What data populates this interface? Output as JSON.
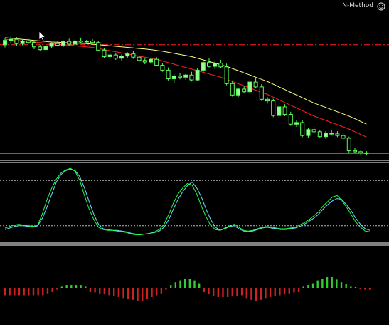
{
  "indicator_label": "N-Method",
  "smiley_icon": "smiley-icon",
  "colors": {
    "background": "#000000",
    "bull_candle": "#9aff9a",
    "bear_candle": "#000000",
    "wick": "#5cff5c",
    "ma_red": "#ff2020",
    "ma_yellow": "#ffff80",
    "dash_red": "#ff2020",
    "price_line": "#8fa0c8",
    "stoch_main": "#66e0ff",
    "stoch_signal": "#22ff44",
    "hist_pos": "#33cc33",
    "hist_neg": "#cc2222",
    "separator": "#ffffff"
  },
  "chart_data": [
    {
      "type": "candlestick",
      "panel": "price",
      "ohlc": [
        [
          100,
          101.2,
          99.5,
          100.8
        ],
        [
          100.8,
          101.5,
          100.2,
          101.0
        ],
        [
          101.0,
          101.4,
          99.8,
          100.2
        ],
        [
          100.2,
          101.0,
          99.9,
          100.7
        ],
        [
          100.7,
          101.1,
          100.1,
          100.4
        ],
        [
          100.4,
          100.8,
          99.2,
          99.6
        ],
        [
          99.6,
          100.0,
          98.9,
          99.1
        ],
        [
          99.1,
          99.9,
          98.8,
          99.7
        ],
        [
          99.7,
          100.4,
          99.3,
          100.2
        ],
        [
          100.2,
          100.6,
          99.7,
          99.9
        ],
        [
          99.9,
          100.8,
          99.6,
          100.6
        ],
        [
          100.6,
          101.1,
          99.9,
          100.1
        ],
        [
          100.1,
          100.9,
          99.8,
          100.7
        ],
        [
          100.7,
          101.3,
          100.2,
          100.5
        ],
        [
          100.5,
          100.9,
          100.1,
          100.7
        ],
        [
          100.7,
          101.0,
          100.2,
          100.4
        ],
        [
          100.4,
          100.7,
          98.8,
          99.0
        ],
        [
          99.0,
          99.4,
          97.5,
          97.8
        ],
        [
          97.8,
          98.4,
          97.3,
          98.1
        ],
        [
          98.1,
          98.5,
          97.2,
          97.5
        ],
        [
          97.5,
          98.2,
          97.1,
          97.9
        ],
        [
          97.9,
          98.6,
          97.6,
          98.3
        ],
        [
          98.3,
          98.8,
          97.4,
          97.7
        ],
        [
          97.7,
          98.0,
          96.8,
          97.1
        ],
        [
          97.1,
          97.6,
          96.4,
          96.8
        ],
        [
          96.8,
          97.5,
          96.5,
          97.3
        ],
        [
          97.3,
          97.7,
          96.0,
          96.2
        ],
        [
          96.2,
          96.6,
          95.0,
          95.3
        ],
        [
          95.3,
          95.8,
          93.4,
          93.7
        ],
        [
          93.7,
          94.5,
          93.0,
          94.2
        ],
        [
          94.2,
          94.8,
          93.6,
          94.0
        ],
        [
          94.0,
          94.6,
          93.5,
          94.4
        ],
        [
          94.4,
          95.0,
          93.2,
          93.5
        ],
        [
          93.5,
          95.6,
          93.3,
          95.3
        ],
        [
          95.3,
          97.0,
          94.9,
          96.7
        ],
        [
          96.7,
          97.5,
          95.8,
          96.0
        ],
        [
          96.0,
          96.9,
          95.5,
          96.6
        ],
        [
          96.6,
          97.2,
          95.7,
          95.9
        ],
        [
          95.9,
          96.5,
          92.5,
          92.8
        ],
        [
          92.8,
          93.4,
          90.4,
          90.7
        ],
        [
          90.7,
          92.0,
          90.3,
          91.8
        ],
        [
          91.8,
          92.4,
          91.0,
          91.3
        ],
        [
          91.3,
          93.4,
          91.0,
          93.1
        ],
        [
          93.1,
          93.8,
          91.9,
          92.2
        ],
        [
          92.2,
          92.7,
          89.6,
          89.9
        ],
        [
          89.9,
          90.3,
          89.1,
          89.6
        ],
        [
          89.6,
          90.0,
          86.6,
          86.9
        ],
        [
          86.9,
          88.8,
          86.5,
          88.5
        ],
        [
          88.5,
          89.0,
          86.8,
          87.1
        ],
        [
          87.1,
          87.6,
          85.0,
          85.3
        ],
        [
          85.3,
          86.0,
          84.8,
          85.6
        ],
        [
          85.6,
          86.1,
          82.9,
          83.2
        ],
        [
          83.2,
          84.6,
          82.8,
          84.3
        ],
        [
          84.3,
          84.9,
          83.5,
          83.9
        ],
        [
          83.9,
          84.2,
          82.7,
          83.0
        ],
        [
          83.0,
          84.0,
          82.6,
          83.6
        ],
        [
          83.6,
          84.3,
          83.2,
          83.5
        ],
        [
          83.5,
          84.0,
          82.9,
          83.2
        ],
        [
          83.2,
          83.6,
          82.2,
          82.7
        ],
        [
          82.7,
          83.0,
          80.0,
          80.4
        ],
        [
          80.4,
          80.9,
          79.9,
          80.2
        ],
        [
          80.2,
          80.6,
          79.6,
          80.0
        ],
        [
          80.0,
          80.3,
          79.5,
          79.9
        ]
      ],
      "ma_red": [
        101.0,
        100.9,
        100.8,
        100.7,
        100.6,
        100.5,
        100.4,
        100.3,
        100.2,
        100.1,
        100.0,
        99.9,
        99.8,
        99.7,
        99.6,
        99.5,
        99.3,
        99.1,
        98.9,
        98.7,
        98.5,
        98.3,
        98.1,
        97.9,
        97.7,
        97.5,
        97.3,
        97.0,
        96.7,
        96.4,
        96.1,
        95.8,
        95.5,
        95.2,
        94.9,
        94.6,
        94.3,
        94.0,
        93.6,
        93.2,
        92.8,
        92.4,
        92.0,
        91.6,
        91.2,
        90.8,
        90.3,
        89.8,
        89.3,
        88.8,
        88.3,
        87.8,
        87.3,
        86.8,
        86.4,
        86.0,
        85.6,
        85.2,
        84.8,
        84.4,
        83.9,
        83.4,
        82.9
      ],
      "ma_yellow": [
        101.3,
        101.2,
        101.1,
        101.0,
        100.9,
        100.8,
        100.7,
        100.6,
        100.5,
        100.45,
        100.4,
        100.35,
        100.3,
        100.25,
        100.2,
        100.1,
        100.0,
        99.9,
        99.8,
        99.7,
        99.6,
        99.5,
        99.4,
        99.3,
        99.2,
        99.1,
        98.95,
        98.8,
        98.6,
        98.4,
        98.2,
        98.0,
        97.8,
        97.5,
        97.2,
        96.9,
        96.6,
        96.3,
        96.0,
        95.6,
        95.2,
        94.8,
        94.4,
        94.0,
        93.6,
        93.2,
        92.7,
        92.2,
        91.7,
        91.2,
        90.7,
        90.2,
        89.7,
        89.2,
        88.8,
        88.4,
        88.0,
        87.6,
        87.2,
        86.8,
        86.3,
        85.8,
        85.3
      ],
      "dashed_level": 100.0,
      "current_price": 79.9,
      "ylim": [
        79.0,
        103.0
      ]
    },
    {
      "type": "line",
      "panel": "stochastic",
      "levels": [
        80,
        20
      ],
      "ylim": [
        0,
        100
      ],
      "series": [
        {
          "values": [
            15,
            17,
            19,
            20,
            20,
            19,
            18,
            20,
            30,
            45,
            62,
            78,
            88,
            93,
            95,
            93,
            85,
            70,
            52,
            35,
            22,
            16,
            15,
            14,
            14,
            13,
            12,
            10,
            9,
            9,
            9,
            10,
            11,
            13,
            18,
            28,
            42,
            55,
            65,
            73,
            78,
            70,
            58,
            42,
            28,
            18,
            14,
            16,
            19,
            20,
            16,
            13,
            12,
            13,
            15,
            17,
            18,
            17,
            16,
            15,
            15,
            16,
            17,
            19,
            22,
            26,
            30,
            35,
            42,
            48,
            53,
            56,
            55,
            48,
            40,
            30,
            22,
            16,
            14
          ]
        },
        {
          "values": [
            17,
            19,
            21,
            22,
            21,
            20,
            19,
            21,
            36,
            55,
            70,
            82,
            90,
            94,
            96,
            92,
            80,
            60,
            42,
            28,
            18,
            15,
            14,
            14,
            13,
            12,
            11,
            9,
            8,
            8,
            9,
            10,
            12,
            15,
            22,
            35,
            50,
            62,
            70,
            76,
            74,
            62,
            46,
            32,
            20,
            15,
            14,
            17,
            20,
            22,
            18,
            14,
            13,
            14,
            16,
            18,
            19,
            18,
            17,
            16,
            16,
            17,
            18,
            21,
            24,
            28,
            33,
            38,
            46,
            52,
            58,
            60,
            54,
            45,
            35,
            25,
            18,
            13,
            12
          ]
        }
      ]
    },
    {
      "type": "bar",
      "panel": "histogram",
      "values": [
        -8,
        -8,
        -8,
        -8,
        -8,
        -8,
        -8,
        -8,
        -8,
        -6,
        -4,
        -2,
        2,
        3,
        3,
        3,
        3,
        2,
        -4,
        -5,
        -6,
        -7,
        -8,
        -9,
        -10,
        -11,
        -12,
        -13,
        -14,
        -14,
        -12,
        -10,
        -8,
        -6,
        -2,
        3,
        6,
        8,
        10,
        10,
        8,
        5,
        -4,
        -7,
        -9,
        -10,
        -10,
        -10,
        -9,
        -9,
        -8,
        -11,
        -13,
        -14,
        -13,
        -11,
        -10,
        -9,
        -8,
        -7,
        -6,
        -5,
        -4,
        2,
        3,
        5,
        8,
        10,
        12,
        12,
        9,
        6,
        4,
        2,
        1,
        -1,
        -2,
        -2
      ]
    }
  ]
}
